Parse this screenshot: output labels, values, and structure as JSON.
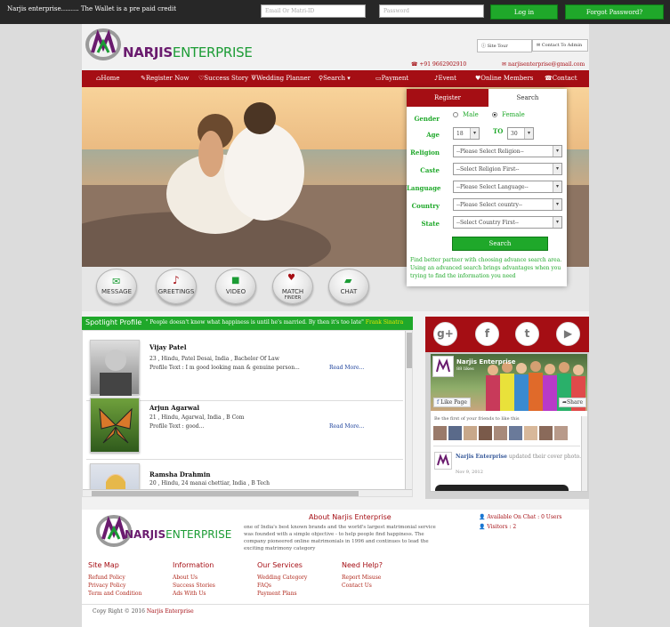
{
  "topbar": {
    "notice": "Narjis enterprise......... The Wallet is a pre paid credit",
    "email_placeholder": "Email Or Matri-ID",
    "password_placeholder": "Password",
    "login_label": "Log in",
    "forgot_label": "Forgot Password?"
  },
  "header": {
    "logo_main": "NARJIS",
    "logo_sub": "ENTERPRISE",
    "site_tour": "Site Tour",
    "contact_admin": "Contact To Admin",
    "phone": "+91 9662902910",
    "email": "narjisenterprise@gmail.com"
  },
  "nav": {
    "home": "Home",
    "register": "Register Now",
    "success": "Success Story",
    "wedding": "Wedding Planner",
    "search": "Search",
    "payment": "Payment",
    "event": "Event",
    "online": "Online Members",
    "contact": "Contact"
  },
  "search": {
    "tab_register": "Register",
    "tab_search": "Search",
    "gender_label": "Gender",
    "male": "Male",
    "female": "Female",
    "age_label": "Age",
    "age_from": "18",
    "to_label": "TO",
    "age_to": "30",
    "religion_label": "Religion",
    "religion_value": "--Please Select Religion--",
    "caste_label": "Caste",
    "caste_value": "--Select Religion First--",
    "language_label": "Language",
    "language_value": "--Please Select Language--",
    "country_label": "Country",
    "country_value": "--Please Select country--",
    "state_label": "State",
    "state_value": "--Select Country First--",
    "button": "Search",
    "hint": "Find better partner with choosing advance search area. Using an advanced search brings advantages when you trying to find the information you need"
  },
  "features": {
    "message": "MESSAGE",
    "greetings": "GREETINGS",
    "video": "VIDEO",
    "match": "MATCH",
    "match_sub": "FINDER",
    "chat": "CHAT"
  },
  "spotlight": {
    "title": "Spotlight Profile",
    "quote": "\" People doesn't know what happiness is until he's married. By then it's too late\" ",
    "quote_author": "Frank Sinatra",
    "profiles": [
      {
        "name": "Vijay Patel",
        "line1": "23 , Hindu, Patel Desai, India , Bachelor Of Law",
        "line2": "Profile Text : I m good looking man & genuine person...",
        "more": "Read More..."
      },
      {
        "name": "Arjun Agarwal",
        "line1": "21 , Hindu, Agarwal, India , B Com",
        "line2": "Profile Text : good...",
        "more": "Read More..."
      },
      {
        "name": "Ramsha Drahmin",
        "line1": "20 , Hindu, 24 manai chettiar, India , B Tech",
        "line2": "",
        "more": ""
      }
    ]
  },
  "social": {
    "gplus": "g+",
    "facebook": "f",
    "twitter": "t",
    "youtube": "▶",
    "fb_page": "Narjis Enterprise",
    "fb_likes": "88 likes",
    "fb_like": "Like Page",
    "fb_share": "Share",
    "fb_friends": "Be the first of your friends to like this",
    "fb_post_name": "Narjis Enterprise",
    "fb_post_action": "updated their cover photo.",
    "fb_post_date": "Nov 9, 2012"
  },
  "footer": {
    "about_title": "About Narjis Enterprise",
    "about_text": "one of India's best known brands and the world's largest matrimonial service was founded with a simple objective - to help people find happiness. The company pioneered online matrimonials in 1996 and continues to lead the exciting matrimony category",
    "online_chat": "Available On Chat : 0 Users",
    "visitors": "Visitors : 2",
    "col1_title": "Site Map",
    "col1": [
      "Refund Policy",
      "Privacy Policy",
      "Term and Condition"
    ],
    "col2_title": "Information",
    "col2": [
      "About Us",
      "Success Stories",
      "Ads With Us"
    ],
    "col3_title": "Our Services",
    "col3": [
      "Wedding Category",
      "FAQs",
      "Payment Plans"
    ],
    "col4_title": "Need Help?",
    "col4": [
      "Report Misuse",
      "Contact Us"
    ],
    "copyright": "Copy Right © 2016 ",
    "copyright_brand": "Narjis Enterprise"
  },
  "colors": {
    "brand_red": "#a50e14",
    "brand_green": "#1fa82a",
    "brand_purple": "#6a1b6e"
  }
}
